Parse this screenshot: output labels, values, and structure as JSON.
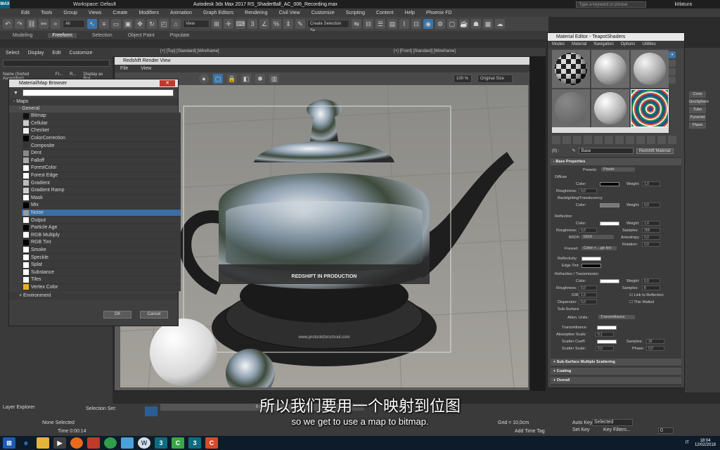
{
  "app": {
    "workspace": "Workspace: Default",
    "title": "Autodesk 3ds Max 2017    RS_ShaderBall_AC_006_Recording.max",
    "search_placeholder": "Type a keyword or phrase",
    "user": "kitlatura"
  },
  "menubar": [
    "Edit",
    "Tools",
    "Group",
    "Views",
    "Create",
    "Modifiers",
    "Animation",
    "Graph Editors",
    "Rendering",
    "Civil View",
    "Customize",
    "Scripting",
    "Content",
    "Help",
    "Phoenix FD"
  ],
  "toolbar": {
    "filter": "All",
    "view": "View",
    "selection_set": "Create Selection Se"
  },
  "ribbon": {
    "tabs": [
      "Modeling",
      "Freeform",
      "Selection",
      "Object Paint",
      "Populate"
    ],
    "active": "Freeform"
  },
  "explorer": {
    "menu": [
      "Select",
      "Display",
      "Edit",
      "Customize"
    ],
    "columns": [
      "Name (Sorted Ascending)",
      "Fr...",
      "R...",
      "Display as Box"
    ],
    "layer": "Layer Explorer",
    "selection_set": "Selection Set:"
  },
  "viewports": {
    "top_left": "[+] [Top] [Standard] [Wireframe]",
    "top_right": "[+] [Front] [Standard] [Wireframe]"
  },
  "render_view": {
    "title": "Redshift Render View",
    "menu": [
      "File",
      "View"
    ],
    "zoom": "100 %",
    "size": "Original Size",
    "teapot_text": "REDSHIFT IN PRODUCTION",
    "base_text": "www.protoolsforschool.com"
  },
  "browser": {
    "title": "Material/Map Browser",
    "section": "Maps",
    "group": "General",
    "items": [
      {
        "name": "Bitmap",
        "sw": "#111111",
        "sel": false
      },
      {
        "name": "Cellular",
        "sw": "#cccccc",
        "sel": false
      },
      {
        "name": "Checker",
        "sw": "#eeeeee",
        "sel": false
      },
      {
        "name": "ColorCorrection",
        "sw": "#000000",
        "sel": false
      },
      {
        "name": "Composite",
        "sw": "#333333",
        "sel": false
      },
      {
        "name": "Dent",
        "sw": "#888888",
        "sel": false
      },
      {
        "name": "Falloff",
        "sw": "#aaaaaa",
        "sel": false
      },
      {
        "name": "ForestColor",
        "sw": "#ffffff",
        "sel": false
      },
      {
        "name": "Forest Edge",
        "sw": "#ffffff",
        "sel": false
      },
      {
        "name": "Gradient",
        "sw": "#bbbbbb",
        "sel": false
      },
      {
        "name": "Gradient Ramp",
        "sw": "#cccccc",
        "sel": false
      },
      {
        "name": "Mask",
        "sw": "#ffffff",
        "sel": false
      },
      {
        "name": "Mix",
        "sw": "#000000",
        "sel": false
      },
      {
        "name": "Noise",
        "sw": "#999999",
        "sel": true
      },
      {
        "name": "Output",
        "sw": "#ffffff",
        "sel": false
      },
      {
        "name": "Particle Age",
        "sw": "#000000",
        "sel": false
      },
      {
        "name": "RGB Multiply",
        "sw": "#ffffff",
        "sel": false
      },
      {
        "name": "RGB Tint",
        "sw": "#000000",
        "sel": false
      },
      {
        "name": "Smoke",
        "sw": "#ffffff",
        "sel": false
      },
      {
        "name": "Speckle",
        "sw": "#ffffff",
        "sel": false
      },
      {
        "name": "Splat",
        "sw": "#ffffff",
        "sel": false
      },
      {
        "name": "Substance",
        "sw": "#ffffff",
        "sel": false
      },
      {
        "name": "Tiles",
        "sw": "#ffffff",
        "sel": false
      },
      {
        "name": "Vertex Color",
        "sw": "#e8b020",
        "sel": false
      }
    ],
    "environment": "+ Environment",
    "ok": "OK",
    "cancel": "Cancel"
  },
  "medit": {
    "title": "Material Editor - TeapotShaders",
    "menu": [
      "Modes",
      "Material",
      "Navigation",
      "Options",
      "Utilities"
    ],
    "slot_label": "(0) :",
    "material_name": "Base",
    "material_type": "Redshift Material",
    "base_props": "Base Properties",
    "presets_label": "Presets:",
    "preset": "Plastic",
    "diffuse": "Diffuse",
    "color": "Color:",
    "weight": "Weight:",
    "roughness": "Roughness:",
    "backlight": "Backlighting/Translucency",
    "reflection": "Reflection",
    "samples": "Samples:",
    "brdf": "BRDF:",
    "ggx": "GGX",
    "anisotropy": "Anisotropy",
    "rotation": "Rotation:",
    "fresnel": "Fresnel:",
    "fresnel_val": "Color + ...ge tint",
    "reflectivity": "Reflectivity:",
    "edge_tint": "Edge Tint:",
    "refraction": "Refraction / Transmission",
    "ior": "IOR:",
    "dispersion": "Dispersion:",
    "link": "Link to Reflection",
    "thin": "Thin Walled",
    "subsurface": "Sub-Surface",
    "atten": "Atten. Units:",
    "atten_val": "Transmittance",
    "transmittance": "Transmittance:",
    "absorption": "Absorption Scale:",
    "scatter_coeff": "Scatter Coeff:",
    "scatter_scale": "Scatter Scale:",
    "phase": "Phase:",
    "v10": "1,0",
    "v00": "0,0",
    "v256": "256",
    "v8": "8",
    "v16": "16",
    "v15": "1,5",
    "v01": "0,1",
    "rollouts": [
      "+ Sub-Surface Multiple Scattering",
      "+ Coating",
      "+ Overall"
    ]
  },
  "command_panel": [
    "Cone",
    "GeoSphere",
    "Tube",
    "Pyramid",
    "Plane"
  ],
  "status": {
    "none_selected": "None Selected",
    "time": "Time  0:00:14",
    "frame": "0 / 100",
    "grid": "Grid = 10,0cm",
    "add_time_tag": "Add Time Tag",
    "auto_key": "Auto Key",
    "selected": "Selected",
    "set_key": "Set Key",
    "key_filters": "Key Filters...",
    "frame_num": "0",
    "it": "IT",
    "clock": "18:04",
    "date": "12/02/2018"
  },
  "subtitles": {
    "cn": "所以我们要用一个映射到位图",
    "en": "so we get to use a map to bitmap."
  }
}
